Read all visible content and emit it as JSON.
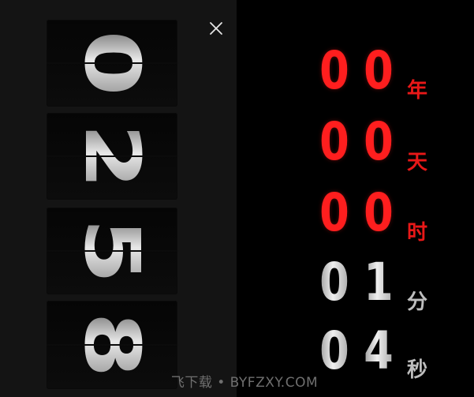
{
  "left_panel": {
    "flip_digits": [
      "0",
      "2",
      "5",
      "8"
    ],
    "close_icon": "close-icon"
  },
  "right_panel": {
    "rows": [
      {
        "digits": [
          "0",
          "0"
        ],
        "unit": "年",
        "color": "#ff1e1e"
      },
      {
        "digits": [
          "0",
          "0"
        ],
        "unit": "天",
        "color": "#ff1e1e"
      },
      {
        "digits": [
          "0",
          "0"
        ],
        "unit": "时",
        "color": "#ff1e1e"
      },
      {
        "digits": [
          "0",
          "1"
        ],
        "unit": "分",
        "color": "#bdbdbd"
      },
      {
        "digits": [
          "0",
          "4"
        ],
        "unit": "秒",
        "color": "#bdbdbd"
      }
    ]
  },
  "watermark": "飞下载 • BYFZXY.COM"
}
